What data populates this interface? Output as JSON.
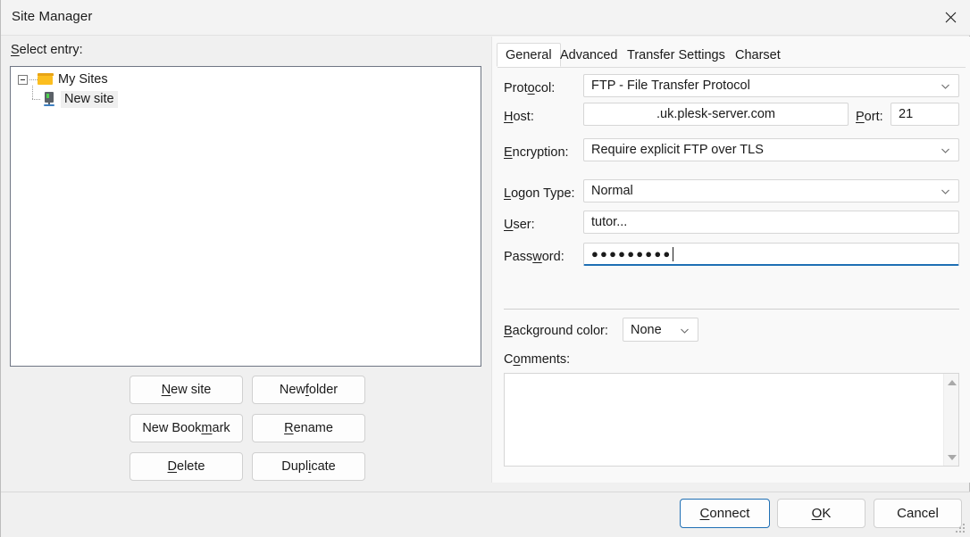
{
  "window": {
    "title": "Site Manager",
    "close_icon": "close-icon"
  },
  "left_panel": {
    "select_entry_label": "Select entry:",
    "tree": {
      "root": {
        "label": "My Sites",
        "icon": "folder-icon",
        "expanded": true
      },
      "children": [
        {
          "label": "New site",
          "icon": "server-icon",
          "selected": true
        }
      ]
    },
    "buttons": [
      {
        "label": "New site"
      },
      {
        "label": "New folder"
      },
      {
        "label": "New Bookmark"
      },
      {
        "label": "Rename"
      },
      {
        "label": "Delete"
      },
      {
        "label": "Duplicate"
      }
    ]
  },
  "right_panel": {
    "tabs": [
      {
        "label": "General",
        "active": true
      },
      {
        "label": "Advanced",
        "active": false
      },
      {
        "label": "Transfer Settings",
        "active": false
      },
      {
        "label": "Charset",
        "active": false
      }
    ],
    "general": {
      "protocol": {
        "label": "Protocol:",
        "value": "FTP - File Transfer Protocol"
      },
      "host": {
        "label": "Host:",
        "value": ".uk.plesk-server.com"
      },
      "port": {
        "label": "Port:",
        "value": "21"
      },
      "encryption": {
        "label": "Encryption:",
        "value": "Require explicit FTP over TLS"
      },
      "logon_type": {
        "label": "Logon Type:",
        "value": "Normal"
      },
      "user": {
        "label": "User:",
        "value": "tutor..."
      },
      "password": {
        "label": "Password:",
        "value": "●●●●●●●●●",
        "focused": true
      },
      "background_color": {
        "label": "Background color:",
        "value": "None"
      },
      "comments": {
        "label": "Comments:",
        "value": ""
      }
    }
  },
  "footer": {
    "connect_label": "Connect",
    "ok_label": "OK",
    "cancel_label": "Cancel"
  },
  "colors": {
    "accent": "#1f6fb4",
    "dialog_bg": "#f0f0f0",
    "panel_bg": "#f9f9f9",
    "field_bg": "#ffffff",
    "folder_icon": "#fcbe1f",
    "selection": "#efefef"
  }
}
